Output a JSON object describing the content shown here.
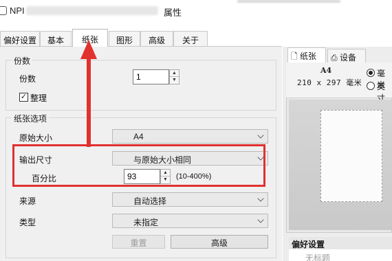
{
  "window": {
    "title_prefix": "NPI",
    "title_suffix": "属性"
  },
  "tabs": [
    {
      "label": "偏好设置",
      "active": false
    },
    {
      "label": "基本",
      "active": false
    },
    {
      "label": "纸张",
      "active": true
    },
    {
      "label": "图形",
      "active": false
    },
    {
      "label": "高级",
      "active": false
    },
    {
      "label": "关于",
      "active": false
    }
  ],
  "copies_group": {
    "title": "份数",
    "copies_label": "份数",
    "copies_value": "1",
    "collate_label": "整理",
    "collate_checked": true
  },
  "paper_group": {
    "title": "纸张选项",
    "original_size_label": "原始大小",
    "original_size_value": "A4",
    "output_size_label": "输出尺寸",
    "output_size_value": "与原始大小相同",
    "percent_label": "百分比",
    "percent_value": "93",
    "percent_range": "(10-400%)",
    "source_label": "来源",
    "source_value": "自动选择",
    "type_label": "类型",
    "type_value": "未指定",
    "reset_label": "重置",
    "advanced_label": "高级"
  },
  "preview": {
    "tabs": [
      "纸张",
      "设备"
    ],
    "size_name": "A4",
    "size_dims": "210 x 297 毫米",
    "units": [
      {
        "label": "毫米",
        "selected": true
      },
      {
        "label": "英寸",
        "selected": false
      }
    ]
  },
  "favorites": {
    "header": "偏好设置",
    "item": "无标题"
  },
  "annotation": {
    "color": "#e0312f"
  }
}
